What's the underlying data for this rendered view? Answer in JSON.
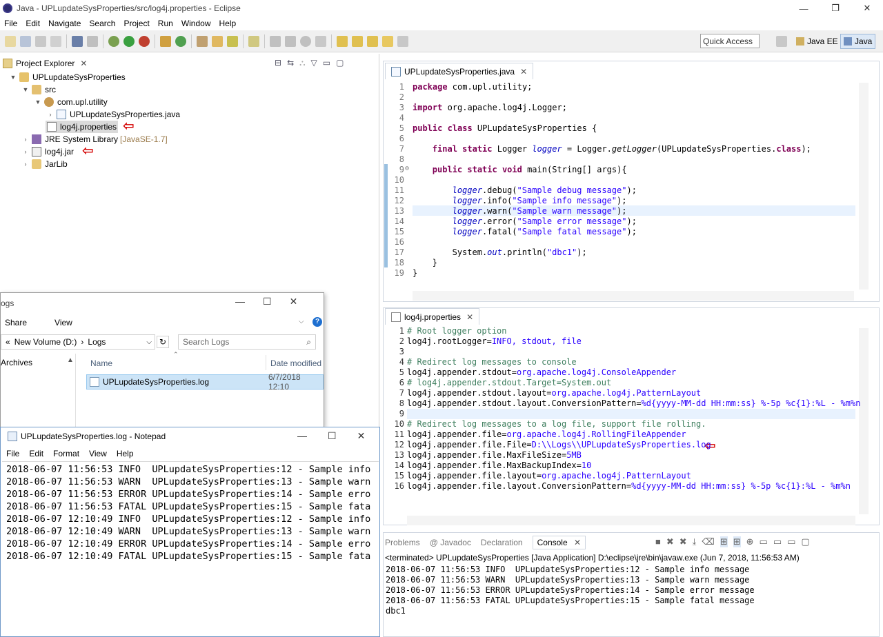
{
  "window": {
    "title": "Java - UPLupdateSysProperties/src/log4j.properties - Eclipse",
    "controls": {
      "minimize": "—",
      "maximize": "❐",
      "close": "✕"
    }
  },
  "menu": [
    "File",
    "Edit",
    "Navigate",
    "Search",
    "Project",
    "Run",
    "Window",
    "Help"
  ],
  "toolbar": {
    "quick_access": "Quick Access",
    "perspectives": [
      "Java EE",
      "Java"
    ]
  },
  "project_explorer": {
    "tab_label": "Project Explorer",
    "tree": [
      {
        "label": "UPLupdateSysProperties",
        "suffix": ""
      },
      {
        "label": "src",
        "suffix": ""
      },
      {
        "label": "com.upl.utility",
        "suffix": ""
      },
      {
        "label": "UPLupdateSysProperties.java",
        "suffix": ""
      },
      {
        "label": "log4j.properties",
        "suffix": ""
      },
      {
        "label": "JRE System Library",
        "suffix": "[JavaSE-1.7]"
      },
      {
        "label": "log4j.jar",
        "suffix": ""
      },
      {
        "label": "JarLib",
        "suffix": ""
      }
    ]
  },
  "java_editor": {
    "tab_label": "UPLupdateSysProperties.java",
    "line_numbers": [
      "1",
      "2",
      "3",
      "4",
      "5",
      "6",
      "7",
      "8",
      "9",
      "10",
      "11",
      "12",
      "13",
      "14",
      "15",
      "16",
      "17",
      "18",
      "19"
    ],
    "code": {
      "l1_kw": "package",
      "l1_rest": " com.upl.utility;",
      "l3_kw": "import",
      "l3_rest": " org.apache.log4j.Logger;",
      "l5_kw": "public class",
      "l5_rest": " UPLupdateSysProperties {",
      "l7_kw": "final static",
      "l7_a": " Logger ",
      "l7_fld": "logger",
      "l7_b": " = Logger.",
      "l7_it": "getLogger",
      "l7_c": "(UPLupdateSysProperties.",
      "l7_kw2": "class",
      "l7_d": ");",
      "l9_kw": "public static void",
      "l9_a": " main(String[] ",
      "l9_args": "args",
      "l9_b": "){",
      "logger": "logger",
      "l11_m": ".debug(",
      "l11_s": "\"Sample debug message\"",
      "l12_m": ".info(",
      "l12_s": "\"Sample info message\"",
      "l13_m": ".warn(",
      "l13_s": "\"Sample warn message\"",
      "l14_m": ".error(",
      "l14_s": "\"Sample error message\"",
      "l15_m": ".fatal(",
      "l15_s": "\"Sample fatal message\"",
      "end": ");",
      "l17_a": "System.",
      "l17_out": "out",
      "l17_b": ".println(",
      "l17_s": "\"dbc1\"",
      "l17_c": ");",
      "l18": "}",
      "l19": "}"
    }
  },
  "props_editor": {
    "tab_label": "log4j.properties",
    "line_numbers": [
      "1",
      "2",
      "3",
      "4",
      "5",
      "6",
      "7",
      "8",
      "9",
      "10",
      "11",
      "12",
      "13",
      "14",
      "15",
      "16"
    ],
    "lines": [
      {
        "key": "",
        "cm": "# Root logger option",
        "val": ""
      },
      {
        "key": "log4j.rootLogger=",
        "cm": "",
        "val": "INFO, stdout, file"
      },
      {
        "key": "",
        "cm": "",
        "val": ""
      },
      {
        "key": "",
        "cm": "# Redirect log messages to console",
        "val": ""
      },
      {
        "key": "log4j.appender.stdout=",
        "cm": "",
        "val": "org.apache.log4j.ConsoleAppender"
      },
      {
        "key": "",
        "cm": "# log4j.appender.stdout.Target=System.out",
        "val": ""
      },
      {
        "key": "log4j.appender.stdout.layout=",
        "cm": "",
        "val": "org.apache.log4j.PatternLayout"
      },
      {
        "key": "log4j.appender.stdout.layout.ConversionPattern=",
        "cm": "",
        "val": "%d{yyyy-MM-dd HH:mm:ss} %-5p %c{1}:%L - %m%n"
      },
      {
        "key": "",
        "cm": "",
        "val": ""
      },
      {
        "key": "",
        "cm": "# Redirect log messages to a log file, support file rolling.",
        "val": ""
      },
      {
        "key": "log4j.appender.file=",
        "cm": "",
        "val": "org.apache.log4j.RollingFileAppender"
      },
      {
        "key": "log4j.appender.file.File=",
        "cm": "",
        "val": "D:\\\\Logs\\\\UPLupdateSysProperties.log"
      },
      {
        "key": "log4j.appender.file.MaxFileSize=",
        "cm": "",
        "val": "5MB"
      },
      {
        "key": "log4j.appender.file.MaxBackupIndex=",
        "cm": "",
        "val": "10"
      },
      {
        "key": "log4j.appender.file.layout=",
        "cm": "",
        "val": "org.apache.log4j.PatternLayout"
      },
      {
        "key": "log4j.appender.file.layout.ConversionPattern=",
        "cm": "",
        "val": "%d{yyyy-MM-dd HH:mm:ss} %-5p %c{1}:%L - %m%n"
      }
    ]
  },
  "console": {
    "tabs": [
      "Problems",
      "@ Javadoc",
      "Declaration",
      "Console"
    ],
    "header": "<terminated> UPLupdateSysProperties [Java Application] D:\\eclipse\\jre\\bin\\javaw.exe (Jun 7, 2018, 11:56:53 AM)",
    "lines": [
      "2018-06-07 11:56:53 INFO  UPLupdateSysProperties:12 - Sample info message",
      "2018-06-07 11:56:53 WARN  UPLupdateSysProperties:13 - Sample warn message",
      "2018-06-07 11:56:53 ERROR UPLupdateSysProperties:14 - Sample error message",
      "2018-06-07 11:56:53 FATAL UPLupdateSysProperties:15 - Sample fatal message",
      "dbc1"
    ]
  },
  "file_explorer": {
    "title": "ogs",
    "ribbon": [
      "Share",
      "View"
    ],
    "address": [
      "«",
      "New Volume (D:)",
      "›",
      "Logs"
    ],
    "search_placeholder": "Search Logs",
    "nav_item": "Archives",
    "columns": [
      "Name",
      "Date modified"
    ],
    "file": {
      "name": "UPLupdateSysProperties.log",
      "date": "6/7/2018 12:10"
    }
  },
  "notepad": {
    "title": "UPLupdateSysProperties.log - Notepad",
    "menu": [
      "File",
      "Edit",
      "Format",
      "View",
      "Help"
    ],
    "lines": [
      "2018-06-07 11:56:53 INFO  UPLupdateSysProperties:12 - Sample info",
      "2018-06-07 11:56:53 WARN  UPLupdateSysProperties:13 - Sample warn",
      "2018-06-07 11:56:53 ERROR UPLupdateSysProperties:14 - Sample erro",
      "2018-06-07 11:56:53 FATAL UPLupdateSysProperties:15 - Sample fata",
      "2018-06-07 12:10:49 INFO  UPLupdateSysProperties:12 - Sample info",
      "2018-06-07 12:10:49 WARN  UPLupdateSysProperties:13 - Sample warn",
      "2018-06-07 12:10:49 ERROR UPLupdateSysProperties:14 - Sample erro",
      "2018-06-07 12:10:49 FATAL UPLupdateSysProperties:15 - Sample fata"
    ]
  },
  "colors": {
    "accent": "#7f0055",
    "string": "#2a00ff",
    "comment": "#3f7f5f",
    "arrow": "#d40000"
  }
}
